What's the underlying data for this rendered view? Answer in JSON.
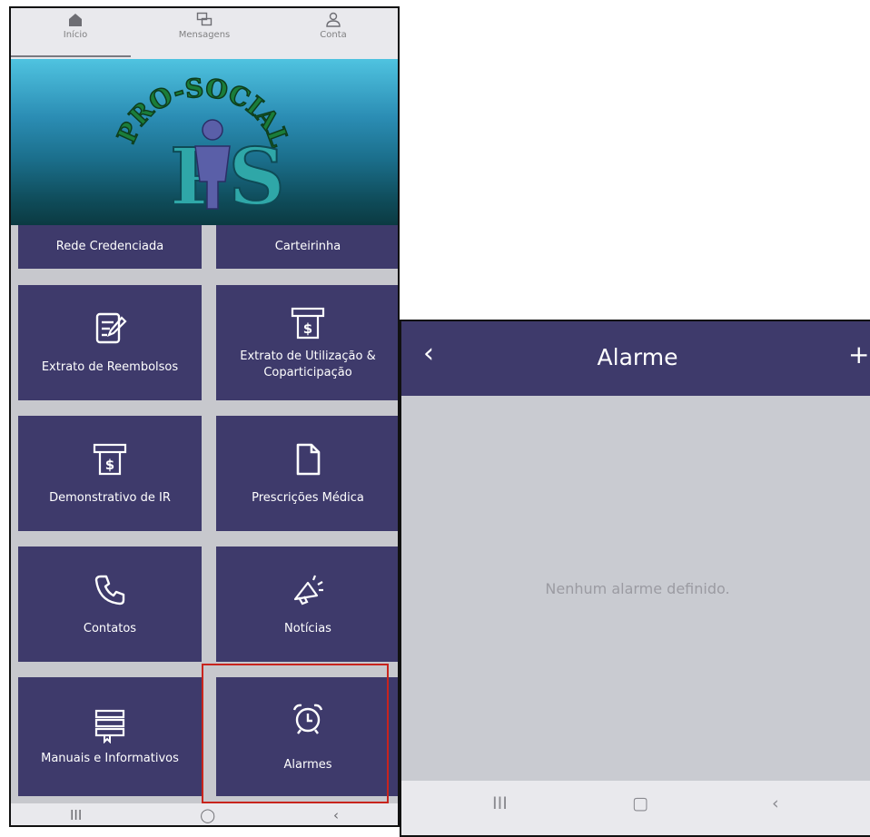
{
  "left_screen": {
    "top_nav": [
      {
        "label": "Início",
        "icon": "home-icon",
        "active": true
      },
      {
        "label": "Mensagens",
        "icon": "chat-icon",
        "active": false
      },
      {
        "label": "Conta",
        "icon": "user-icon",
        "active": false
      }
    ],
    "banner": {
      "logo_top_text": "PRO-SOCIAL",
      "logo_letters": "PS"
    },
    "tiles": [
      {
        "label": "Rede Credenciada",
        "icon": ""
      },
      {
        "label": "Carteirinha",
        "icon": ""
      },
      {
        "label": "Extrato de Reembolsos",
        "icon": "edit-document-icon"
      },
      {
        "label": "Extrato de Utilização & Coparticipação",
        "icon": "atm-receipt-icon"
      },
      {
        "label": "Demonstrativo de IR",
        "icon": "atm-receipt-icon"
      },
      {
        "label": "Prescrições Médica",
        "icon": "file-icon"
      },
      {
        "label": "Contatos",
        "icon": "phone-icon"
      },
      {
        "label": "Notícias",
        "icon": "megaphone-icon"
      },
      {
        "label": "Manuais e Informativos",
        "icon": "books-icon"
      },
      {
        "label": "Alarmes",
        "icon": "alarm-clock-icon"
      }
    ],
    "system_nav": {
      "recents": "III",
      "home": "◯",
      "back": "‹"
    }
  },
  "right_screen": {
    "header": {
      "title": "Alarme",
      "back": "‹",
      "add": "+"
    },
    "empty_message": "Nenhum alarme definido.",
    "system_nav": {
      "recents": "III",
      "home": "▢",
      "back": "‹"
    }
  },
  "colors": {
    "tile_bg": "#3e3a6b",
    "header_bg": "#3e3a6b",
    "highlight": "#c8241d",
    "screen_bg": "#c9cbd1"
  }
}
